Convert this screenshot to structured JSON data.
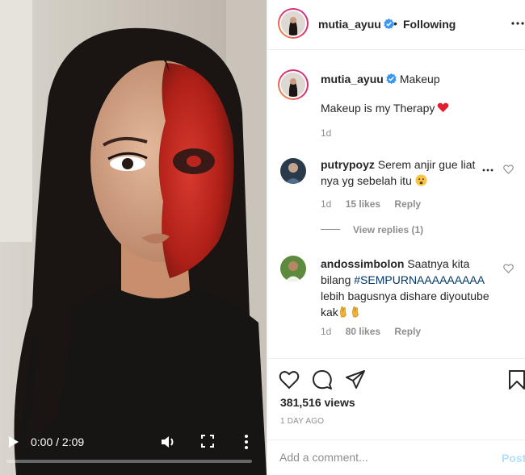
{
  "video": {
    "time_display": "0:00 / 2:09",
    "progress": 0.0
  },
  "post_header": {
    "username": "mutia_ayuu",
    "separator": "•",
    "follow_state": "Following"
  },
  "caption": {
    "username": "mutia_ayuu",
    "category": "Makeup",
    "text": "Makeup is my Therapy",
    "time": "1d"
  },
  "comments": [
    {
      "username": "putrypoyz",
      "text": "Serem anjir gue liat nya yg sebelah itu",
      "time": "1d",
      "likes": "15 likes",
      "reply_label": "Reply",
      "view_replies": "View replies (1)"
    },
    {
      "username": "andossimbolon",
      "text_before": "Saatnya kita bilang ",
      "hashtag": "#SEMPURNAAAAAAAAA",
      "text_after": " lebih bagusnya dishare diyoutube kak",
      "time": "1d",
      "likes": "80 likes",
      "reply_label": "Reply"
    }
  ],
  "stats": {
    "views": "381,516 views",
    "date": "1 DAY AGO"
  },
  "comment_box": {
    "placeholder": "Add a comment...",
    "post_label": "Post"
  },
  "icons": {
    "like": "heart-icon",
    "comment": "comment-icon",
    "share": "paper-plane-icon",
    "save": "bookmark-icon",
    "verified": "verified-badge-icon"
  },
  "colors": {
    "verified_blue": "#3897f0",
    "link_blue": "#00376b",
    "post_disabled": "#b2dffc",
    "muted": "#8e8e8e"
  }
}
